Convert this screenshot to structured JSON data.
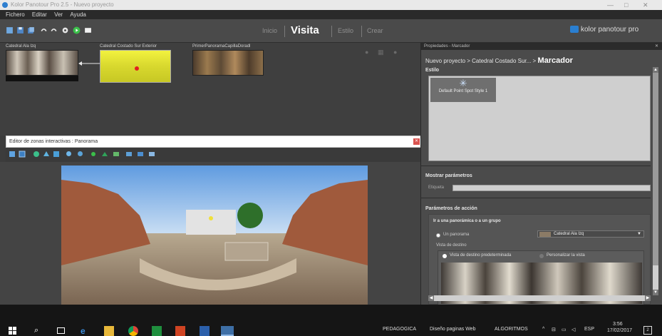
{
  "window": {
    "title": "Kolor Panotour Pro 2.5 - Nuevo proyecto"
  },
  "menu": [
    "Fichero",
    "Editar",
    "Ver",
    "Ayuda"
  ],
  "modes": [
    {
      "label": "Inicio",
      "active": false
    },
    {
      "label": "Visita",
      "active": true
    },
    {
      "label": "Estilo",
      "active": false
    },
    {
      "label": "Crear",
      "active": false
    }
  ],
  "brand": {
    "label": "kolor panotour pro"
  },
  "panoramas": [
    {
      "label": "Catedral Ala Izq"
    },
    {
      "label": "Catedral Costado Sur Exterior"
    },
    {
      "label": "PrimerPanoramaCapillaDoradl"
    }
  ],
  "editor": {
    "title": "Editor de zonas interactivas : Panorama"
  },
  "panel": {
    "header": "Propiedades - Marcador",
    "breadcrumb_prefix": "Nuevo proyecto > Catedral Costado Sur... >",
    "breadcrumb_current": "Marcador",
    "style_section": "Estilo",
    "style_item": "Default Point Spot Style 1",
    "params_section": "Mostrar parámetros",
    "label_field": "Etiqueta",
    "actions_section": "Parámetros de acción",
    "goto_group": "Ir a una panorámica o a un grupo",
    "radio_panorama": "Un panorama",
    "selected_panorama": "Catedral Ala Izq",
    "dest_view": "Vista de destino",
    "radio_default": "Vista de destino predeterminada",
    "radio_custom": "Personalizar la vista"
  },
  "taskbar": {
    "items": [
      "PEDAGOGICA",
      "Diseño paginas Web",
      "ALGORITMOS"
    ],
    "lang": "ESP",
    "time": "3:56",
    "date": "17/02/2017",
    "badge": "2"
  },
  "colors": {
    "accent": "#2f7fd0",
    "hotspot": "#e02020",
    "selection": "#e8e83a"
  }
}
